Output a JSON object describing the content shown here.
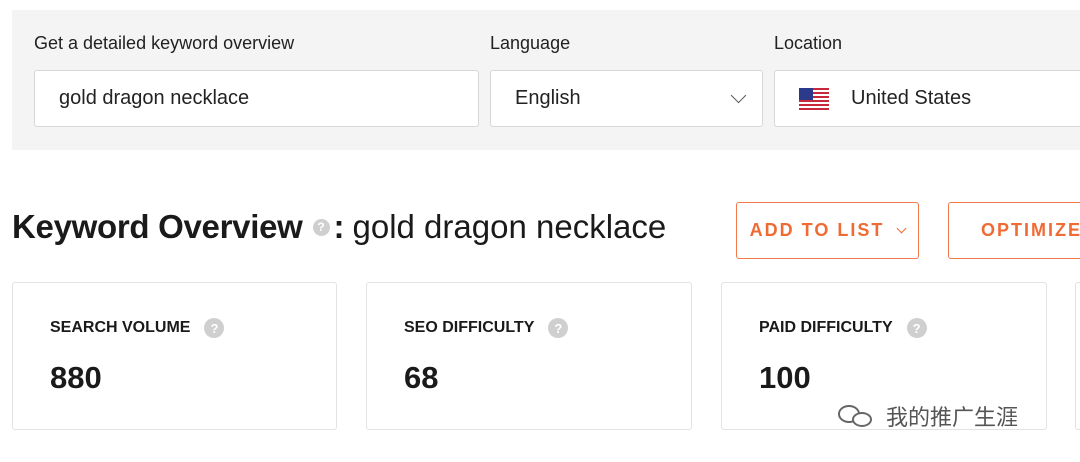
{
  "search": {
    "keyword_label": "Get a detailed keyword overview",
    "keyword_value": "gold dragon necklace",
    "language_label": "Language",
    "language_value": "English",
    "location_label": "Location",
    "location_value": "United States",
    "location_flag_icon": "us-flag-icon"
  },
  "overview": {
    "title": "Keyword Overview",
    "help_glyph": "?",
    "colon": ":",
    "keyword": "gold dragon necklace"
  },
  "actions": {
    "add_to_list": "ADD TO LIST",
    "optimize": "OPTIMIZE"
  },
  "metrics": [
    {
      "label": "SEARCH VOLUME",
      "value": "880"
    },
    {
      "label": "SEO DIFFICULTY",
      "value": "68"
    },
    {
      "label": "PAID DIFFICULTY",
      "value": "100"
    }
  ],
  "watermark": {
    "text": "我的推广生涯",
    "icon": "wechat-icon"
  },
  "colors": {
    "accent": "#f06a34",
    "panel_bg": "#f4f4f4",
    "help_icon": "#cfcfcf",
    "us_flag_red": "#c8283c",
    "us_flag_blue": "#2c3a8c"
  }
}
